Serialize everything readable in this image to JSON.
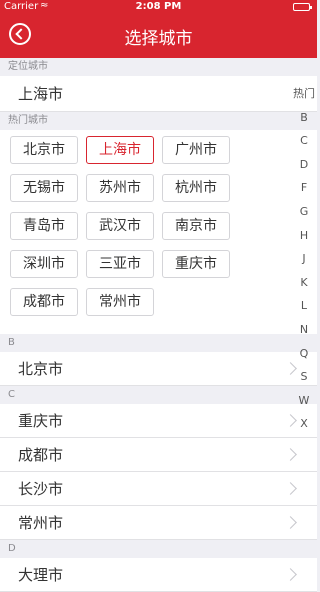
{
  "status_bar": {
    "carrier": "Carrier",
    "time": "2:08 PM"
  },
  "nav": {
    "title": "选择城市"
  },
  "location_section": {
    "header": "定位城市",
    "city": "上海市"
  },
  "hot_section": {
    "header": "热门城市",
    "cities": [
      "北京市",
      "上海市",
      "广州市",
      "无锡市",
      "苏州市",
      "杭州市",
      "青岛市",
      "武汉市",
      "南京市",
      "深圳市",
      "三亚市",
      "重庆市",
      "成都市",
      "常州市"
    ],
    "selected": "上海市"
  },
  "sections": [
    {
      "header": "B",
      "cities": [
        "北京市"
      ]
    },
    {
      "header": "C",
      "cities": [
        "重庆市",
        "成都市",
        "长沙市",
        "常州市"
      ]
    },
    {
      "header": "D",
      "cities": [
        "大理市"
      ]
    }
  ],
  "index_letters": [
    "热门",
    "B",
    "C",
    "D",
    "F",
    "G",
    "H",
    "J",
    "K",
    "L",
    "N",
    "Q",
    "S",
    "W",
    "X"
  ],
  "colors": {
    "brand": "#d8252f",
    "background": "#efeff4"
  }
}
